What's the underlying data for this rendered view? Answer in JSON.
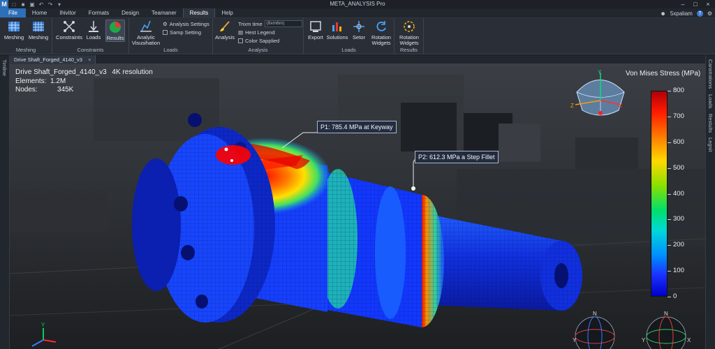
{
  "app": {
    "title": "META_ANALYSIS Pro",
    "logo_letter": "M"
  },
  "menu": {
    "tabs": [
      "File",
      "Home",
      "Ihivitor",
      "Formats",
      "Design",
      "Teamaner",
      "Results",
      "Help"
    ],
    "active": "Results"
  },
  "user": {
    "name": "5xpaliam"
  },
  "ribbon": {
    "meshing": {
      "label": "Meshing",
      "buttons": [
        "Meshing",
        "Meshing"
      ]
    },
    "constraints": {
      "label": "Constraints",
      "buttons": [
        "Constraints",
        "Loads",
        "Results"
      ]
    },
    "loads": {
      "label": "Loads",
      "button": "Analyiic Visusihation",
      "settings": [
        "Analysis Settings",
        "Samp Setting"
      ]
    },
    "analysis": {
      "label": "Analysis",
      "button": "Analysis",
      "trim_label": "Trixm time",
      "trim_value": "(8xm6m)",
      "options": [
        "Hest Legend",
        "Color Sapplied"
      ]
    },
    "loads2": {
      "label": "Loads",
      "buttons": [
        "Export",
        "Solutions",
        "Setor",
        "Rotation Widgets"
      ]
    },
    "results": {
      "label": "Results",
      "button": "Rotation Widgets"
    }
  },
  "document": {
    "tab": "Drive Shaft_Forged_4140_v3"
  },
  "side_tabs": {
    "left": "Timline",
    "right": [
      "Canstrations",
      "Loads",
      "Restults",
      "Legnit"
    ]
  },
  "model_info": {
    "name": "Drive Shaft_Forged_4140_v3",
    "resolution": "4K resolution",
    "elements_label": "Elements:",
    "elements": "1.2M",
    "nodes_label": "Nodes:",
    "nodes": "345K"
  },
  "callouts": [
    {
      "text": "P1: 785.4 MPa at Keyway"
    },
    {
      "text": "P2: 612.3 MPa a Step Fillet"
    }
  ],
  "legend": {
    "title": "Von Mises Stress (MPa)",
    "ticks": [
      "800",
      "700",
      "600",
      "500",
      "400",
      "300",
      "200",
      "100",
      "0"
    ]
  },
  "orientation_cube": {
    "y": "Y",
    "z": "Z",
    "x": "X"
  },
  "gizmos": {
    "left": {
      "y": "Y",
      "n": "N"
    },
    "right": {
      "y": "Y",
      "x": "X",
      "n": "N"
    }
  },
  "colors": {
    "accent": "#2d6fb8",
    "max_stress": "#ff1a00",
    "min_stress": "#0000c8"
  }
}
